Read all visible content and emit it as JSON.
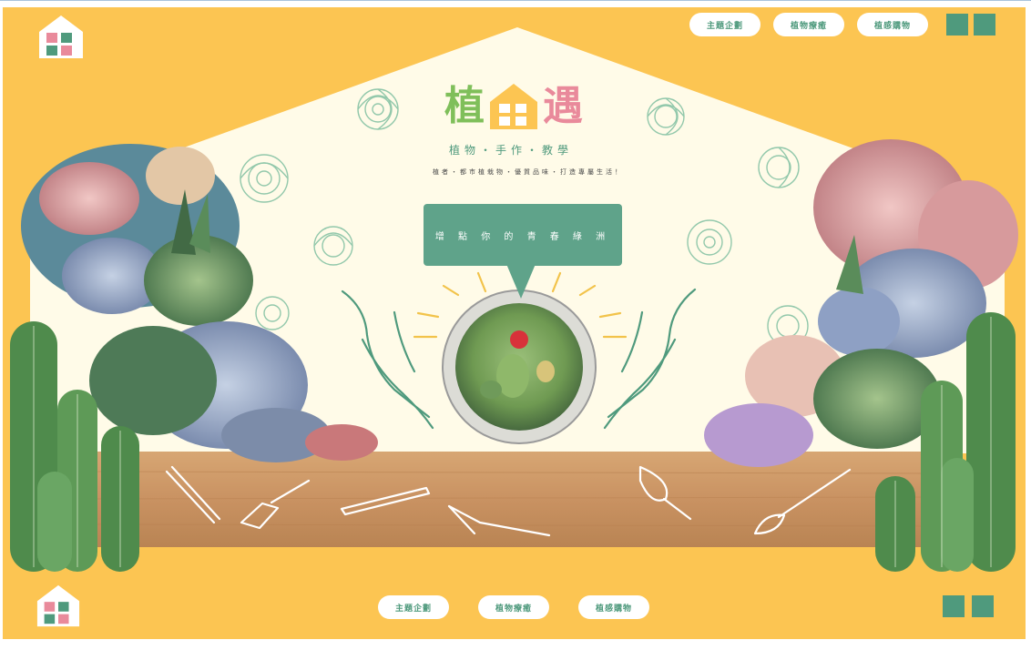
{
  "header": {
    "nav": [
      {
        "label": "主題企劃"
      },
      {
        "label": "植物療癒"
      },
      {
        "label": "植感購物"
      }
    ]
  },
  "hero": {
    "brand": {
      "char1": "植",
      "char3": "遇"
    },
    "tagline": "植物・手作・教學",
    "subline": "植者・都市植栽物・優質品味・打造專屬生活！",
    "bubble": "增 點 你 的 青 春 綠 洲"
  },
  "footer": {
    "nav": [
      {
        "label": "主題企劃"
      },
      {
        "label": "植物療癒"
      },
      {
        "label": "植感購物"
      }
    ]
  },
  "colors": {
    "background": "#fcc552",
    "cream": "#fffbe8",
    "accent_green": "#4f9a7d",
    "pink": "#e98a9b",
    "leaf_green": "#7fbf5a",
    "wood": "#c99262"
  },
  "icons": [
    "house-logo-icon",
    "hands-icon",
    "terrarium-icon",
    "shovel-icon",
    "tweezers-icon",
    "whisk-icon",
    "cactus-icon",
    "succulent-icon"
  ]
}
